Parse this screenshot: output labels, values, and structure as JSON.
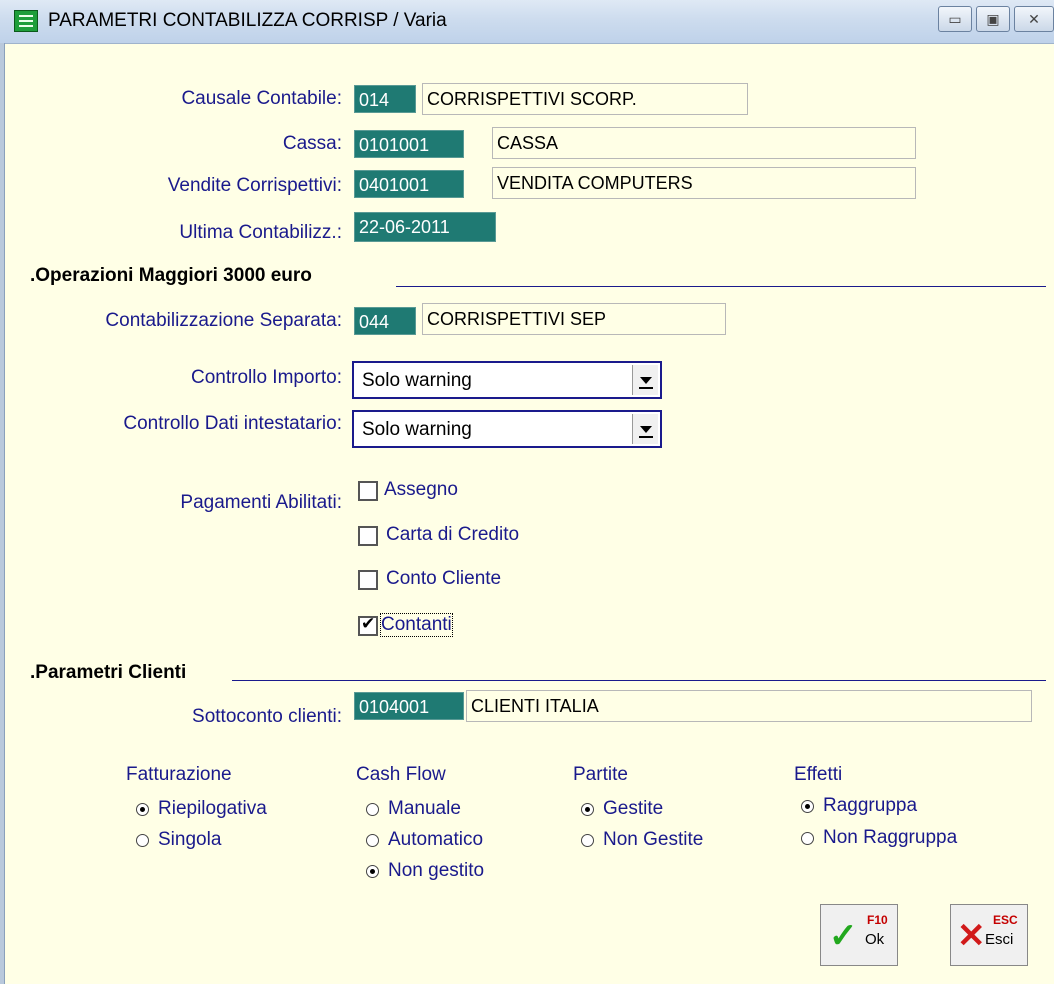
{
  "window": {
    "title": "PARAMETRI CONTABILIZZA CORRISP / Varia"
  },
  "fields": {
    "causale": {
      "label": "Causale Contabile:",
      "code": "014",
      "desc": "CORRISPETTIVI SCORP."
    },
    "cassa": {
      "label": "Cassa:",
      "code": "0101001",
      "desc": "CASSA"
    },
    "vendite": {
      "label": "Vendite Corrispettivi:",
      "code": "0401001",
      "desc": "VENDITA COMPUTERS"
    },
    "ultima": {
      "label": "Ultima Contabilizz.:",
      "value": "22-06-2011"
    }
  },
  "section_operazioni": {
    "title": ".Operazioni Maggiori 3000 euro",
    "separata": {
      "label": "Contabilizzazione Separata:",
      "code": "044",
      "desc": "CORRISPETTIVI SEP"
    },
    "controllo_importo": {
      "label": "Controllo Importo:",
      "value": "Solo warning"
    },
    "controllo_dati": {
      "label": "Controllo Dati intestatario:",
      "value": "Solo warning"
    },
    "pagamenti": {
      "label": "Pagamenti Abilitati:",
      "items": [
        {
          "label": "Assegno",
          "checked": false
        },
        {
          "label": "Carta di Credito",
          "checked": false
        },
        {
          "label": "Conto Cliente",
          "checked": false
        },
        {
          "label": "Contanti",
          "checked": true
        }
      ]
    }
  },
  "section_clienti": {
    "title": ".Parametri Clienti",
    "sottoconto": {
      "label": "Sottoconto clienti:",
      "code": "0104001",
      "desc": "CLIENTI ITALIA"
    },
    "groups": [
      {
        "title": "Fatturazione",
        "options": [
          {
            "label": "Riepilogativa",
            "selected": true
          },
          {
            "label": "Singola",
            "selected": false
          }
        ]
      },
      {
        "title": "Cash Flow",
        "options": [
          {
            "label": "Manuale",
            "selected": false
          },
          {
            "label": "Automatico",
            "selected": false
          },
          {
            "label": "Non gestito",
            "selected": true
          }
        ]
      },
      {
        "title": "Partite",
        "options": [
          {
            "label": "Gestite",
            "selected": true
          },
          {
            "label": "Non Gestite",
            "selected": false
          }
        ]
      },
      {
        "title": "Effetti",
        "options": [
          {
            "label": "Raggruppa",
            "selected": true
          },
          {
            "label": "Non Raggruppa",
            "selected": false
          }
        ]
      }
    ]
  },
  "buttons": {
    "ok": {
      "label": "Ok",
      "key": "F10"
    },
    "esci": {
      "label": "Esci",
      "key": "ESC"
    }
  },
  "colors": {
    "code_bg": "#1f7a73",
    "label": "#1a1a8c",
    "window_bg": "#ffffe6"
  }
}
